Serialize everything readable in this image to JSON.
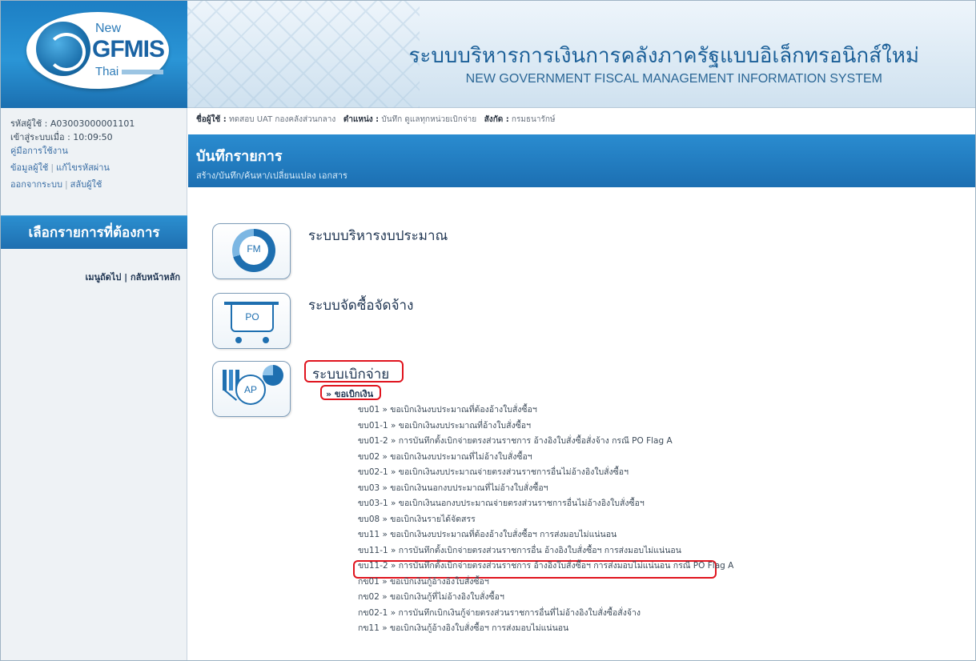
{
  "header": {
    "logo_new": "New",
    "logo_gfmis": "GFMIS",
    "logo_thai": "Thai",
    "title_th": "ระบบบริหารการเงินการคลังภาครัฐแบบอิเล็กทรอนิกส์ใหม่",
    "title_en": "NEW GOVERNMENT FISCAL MANAGEMENT INFORMATION SYSTEM"
  },
  "sidebar": {
    "user_code": "รหัสผู้ใช้ : A03003000001101",
    "login_time": "เข้าสู่ระบบเมื่อ : 10:09:50",
    "manual": "คู่มือการใช้งาน",
    "profile": "ข้อมูลผู้ใช้",
    "change_password": "แก้ไขรหัสผ่าน",
    "logout": "ออกจากระบบ",
    "switch_user": "สลับผู้ใช้",
    "menu_title": "เลือกรายการที่ต้องการ",
    "next_menu": "เมนูถัดไป",
    "home": "กลับหน้าหลัก"
  },
  "userbar": {
    "name_label": "ชื่อผู้ใช้ :",
    "name_value": "ทดสอบ UAT กองคลังส่วนกลาง",
    "position_label": "ตำแหน่ง :",
    "position_value": "บันทึก ดูแลทุกหน่วยเบิกจ่าย",
    "affiliation_label": "สังกัด :",
    "affiliation_value": "กรมธนารักษ์"
  },
  "banner": {
    "title": "บันทึกรายการ",
    "subtitle": "สร้าง/บันทึก/ค้นหา/เปลี่ยนแปลง เอกสาร"
  },
  "systems": {
    "fm": {
      "icon_text": "FM",
      "title": "ระบบบริหารงบประมาณ"
    },
    "po": {
      "icon_text": "PO",
      "title": "ระบบจัดซื้อจัดจ้าง"
    },
    "ap": {
      "icon_text": "AP",
      "title": "ระบบเบิกจ่าย",
      "subtitle": "» ขอเบิกเงิน"
    }
  },
  "ap_items": [
    "ขบ01 » ขอเบิกเงินงบประมาณที่ต้องอ้างใบสั่งซื้อฯ",
    "ขบ01-1 » ขอเบิกเงินงบประมาณที่อ้างใบสั่งซื้อฯ",
    "ขบ01-2 » การบันทึกตั้งเบิกจ่ายตรงส่วนราชการ อ้างอิงใบสั่งซื้อสั่งจ้าง กรณี PO Flag A",
    "ขบ02 » ขอเบิกเงินงบประมาณที่ไม่อ้างใบสั่งซื้อฯ",
    "ขบ02-1 » ขอเบิกเงินงบประมาณจ่ายตรงส่วนราชการอื่นไม่อ้างอิงใบสั่งซื้อฯ",
    "ขบ03 » ขอเบิกเงินนอกงบประมาณที่ไม่อ้างใบสั่งซื้อฯ",
    "ขบ03-1 » ขอเบิกเงินนอกงบประมาณจ่ายตรงส่วนราชการอื่นไม่อ้างอิงใบสั่งซื้อฯ",
    "ขบ08 » ขอเบิกเงินรายได้จัดสรร",
    "ขบ11 » ขอเบิกเงินงบประมาณที่ต้องอ้างใบสั่งซื้อฯ การส่งมอบไม่แน่นอน",
    "ขบ11-1 » การบันทึกตั้งเบิกจ่ายตรงส่วนราชการอื่น อ้างอิงใบสั่งซื้อฯ การส่งมอบไม่แน่นอน",
    "ขบ11-2 » การบันทึกตั้งเบิกจ่ายตรงส่วนราชการ อ้างอิงใบสั่งซื้อฯ การส่งมอบไม่แน่นอน กรณี PO Flag A",
    "กข01 » ขอเบิกเงินกู้อ้างอิงใบสั่งซื้อฯ",
    "กข02 » ขอเบิกเงินกู้ที่ไม่อ้างอิงใบสั่งซื้อฯ",
    "กข02-1 » การบันทึกเบิกเงินกู้จ่ายตรงส่วนราชการอื่นที่ไม่อ้างอิงใบสั่งซื้อสั่งจ้าง",
    "กข11 » ขอเบิกเงินกู้อ้างอิงใบสั่งซื้อฯ การส่งมอบไม่แน่นอน"
  ],
  "colors": {
    "accent_blue": "#1f6fb0",
    "highlight_red": "#e0141e"
  }
}
